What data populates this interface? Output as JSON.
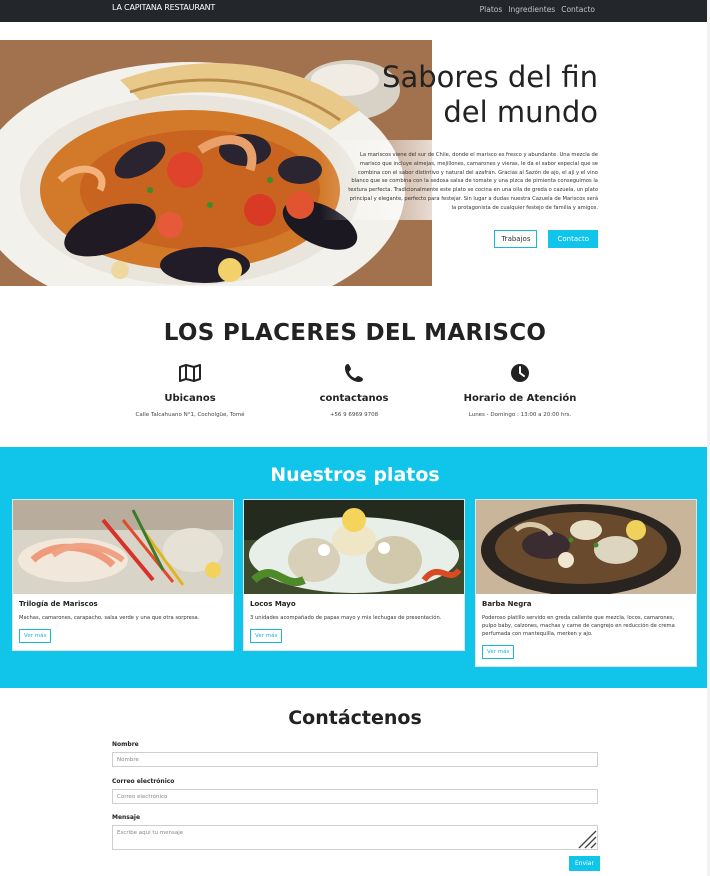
{
  "navbar": {
    "brand": "LA CAPITANA RESTAURANT",
    "links": [
      "Platos",
      "Ingredientes",
      "Contacto"
    ]
  },
  "hero": {
    "title": "Sabores del fin del mundo",
    "description": "La mariscos viene del sur de Chile, donde el marisco es fresco y abundante. Una mezcla de marisco que incluye almejas, mejillones, camarones y vieras, le da el sabor especial que se combina con el sabor distintivo y natural del azafrán. Gracias al Sazón de ajo, el ají y el vino blanco que se combina con la sedosa salsa de tomate y una pizca de pimienta conseguimos la textura perfecta. Tradicionalmente este plato se cocina en una olla de greda o cazuela, un plato principal y elegante, perfecto para festejar. Sin lugar a dudas nuestra Cazuela de Mariscos será la protagonista de cualquier festejo de familia y amigos.",
    "btn_trabajos": "Trabajos",
    "btn_contacto": "Contacto"
  },
  "placeres": {
    "title": "LOS PLACERES DEL MARISCO",
    "features": [
      {
        "icon": "map-icon",
        "title": "Ubicanos",
        "text": "Calle Talcahuano N°1, Cocholgüe, Tomé"
      },
      {
        "icon": "phone-icon",
        "title": "contactanos",
        "text": "+56 9 6969 9708"
      },
      {
        "icon": "clock-icon",
        "title": "Horario de Atención",
        "text": "Lunes - Domingo : 13:00 a 20:00 hrs."
      }
    ]
  },
  "platos": {
    "title": "Nuestros platos",
    "cards": [
      {
        "title": "Trilogía de Mariscos",
        "text": "Machas, camarones, carapacho, salsa verde y una que otra sorpresa.",
        "button": "Ver más"
      },
      {
        "title": "Locos Mayo",
        "text": "3 unidades acompañado de papas mayo y mix lechugas de presentación.",
        "button": "Ver más"
      },
      {
        "title": "Barba Negra",
        "text": "Poderoso platillo servido en greda caliente que mezcla, locos, camarones, pulpo baby, calzones, machas y carne de cangrejo en reducción de crema perfumada con mantequilla, merken y ajo.",
        "button": "Ver más"
      }
    ]
  },
  "contact": {
    "title": "Contáctenos",
    "name_label": "Nombre",
    "name_placeholder": "Nombre",
    "email_label": "Correo electrónico",
    "email_placeholder": "Correo electrónico",
    "message_label": "Mensaje",
    "message_placeholder": "Escribe aquí tu mensaje",
    "send": "Enviar"
  },
  "colors": {
    "accent": "#10c4ea",
    "navbar": "#23272b"
  }
}
